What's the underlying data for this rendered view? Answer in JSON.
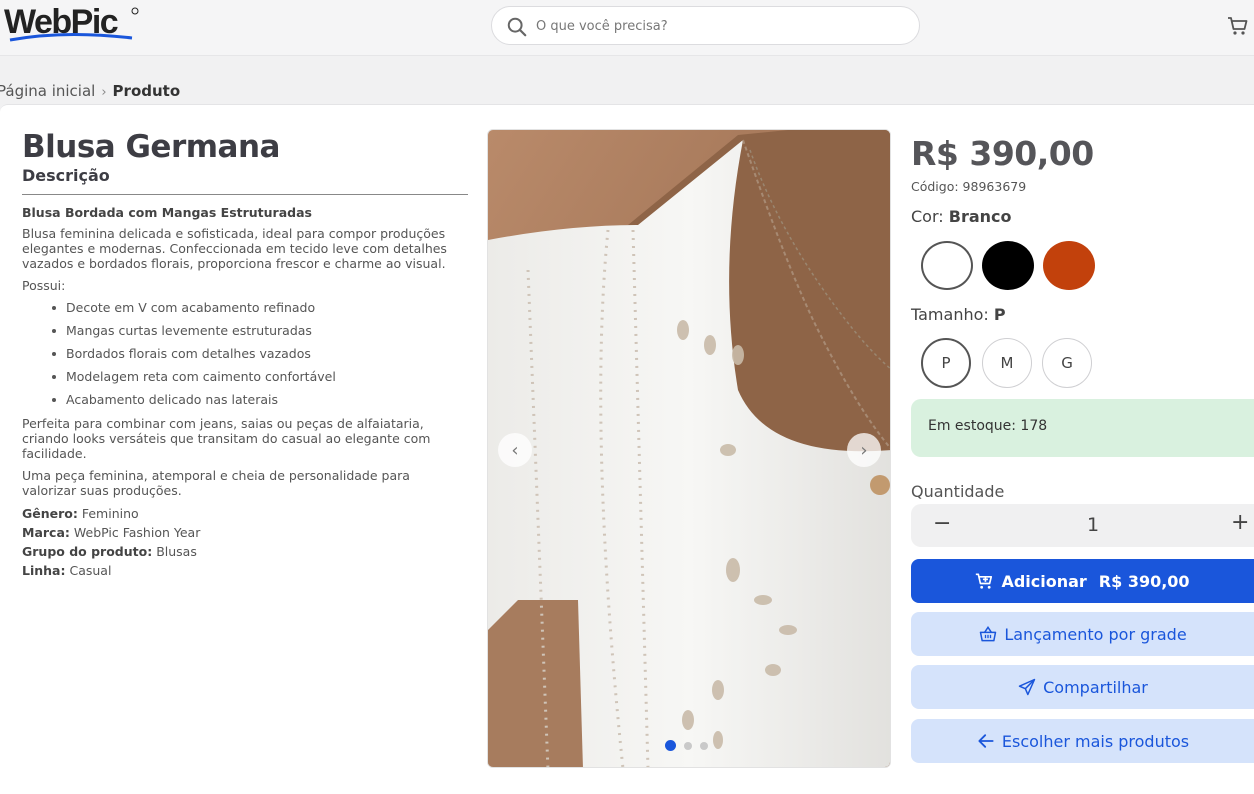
{
  "header": {
    "logo_text": "WebPic",
    "search_placeholder": "O que você precisa?"
  },
  "breadcrumb": {
    "home": "Página inicial",
    "separator": "›",
    "current": "Produto"
  },
  "product": {
    "title": "Blusa Germana",
    "description_label": "Descrição",
    "description_heading": "Blusa Bordada com Mangas Estruturadas",
    "description_intro": "Blusa feminina delicada e sofisticada, ideal para compor produções elegantes e modernas. Confeccionada em tecido leve com detalhes vazados e bordados florais, proporciona frescor e charme ao visual.",
    "features_label": "Possui:",
    "features": [
      "Decote em V com acabamento refinado",
      "Mangas curtas levemente estruturadas",
      "Bordados florais com detalhes vazados",
      "Modelagem reta com caimento confortável",
      "Acabamento delicado nas laterais"
    ],
    "paragraph_2": "Perfeita para combinar com jeans, saias ou peças de alfaiataria, criando looks versáteis que transitam do casual ao elegante com facilidade.",
    "paragraph_3": "Uma peça feminina, atemporal e cheia de personalidade para valorizar suas produções.",
    "attributes": [
      {
        "label": "Gênero:",
        "value": "Feminino"
      },
      {
        "label": "Marca:",
        "value": "WebPic Fashion Year"
      },
      {
        "label": "Grupo do produto:",
        "value": "Blusas"
      },
      {
        "label": "Linha:",
        "value": "Casual"
      }
    ],
    "price": "R$ 390,00",
    "code": "Código: 98963679",
    "color_label": "Cor:",
    "color_selected": "Branco",
    "colors": [
      {
        "name": "Branco",
        "hex": "#ffffff"
      },
      {
        "name": "Preto",
        "hex": "#000000"
      },
      {
        "name": "Laranja",
        "hex": "#c2410c"
      }
    ],
    "size_label": "Tamanho:",
    "size_selected": "P",
    "sizes": [
      "P",
      "M",
      "G"
    ],
    "stock_text": "Em estoque: 178",
    "quantity_label": "Quantidade",
    "quantity": "1",
    "minus": "−",
    "plus": "+",
    "carousel": {
      "prev": "‹",
      "next": "›",
      "slides": 3,
      "active_slide": 1
    }
  },
  "actions": {
    "add_label": "Adicionar",
    "add_price": "R$ 390,00",
    "grid_label": "Lançamento por grade",
    "share_label": "Compartilhar",
    "more_label": "Escolher mais produtos"
  },
  "colors": {
    "primary": "#1a56db",
    "secondary_bg": "#d5e3fb",
    "stock_bg": "#d9f1df"
  }
}
